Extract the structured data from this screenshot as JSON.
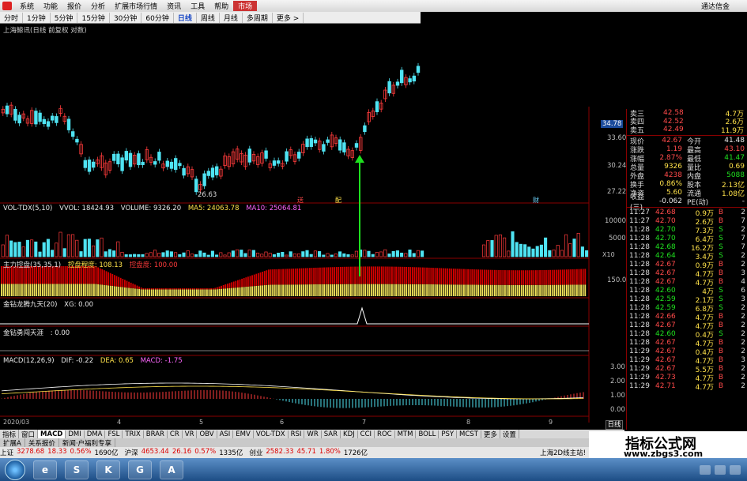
{
  "menu": {
    "items": [
      "系统",
      "功能",
      "报价",
      "分析",
      "扩展市场行情",
      "资讯",
      "工具",
      "帮助",
      "市场"
    ],
    "active_index": 8,
    "window_title": "通达信金"
  },
  "periods": {
    "items": [
      "分时",
      "1分钟",
      "5分钟",
      "15分钟",
      "30分钟",
      "60分钟",
      "日线",
      "周线",
      "月线",
      "多周期",
      "更多 >"
    ],
    "active_index": 6
  },
  "stock_title": "上海鲸讯(日线 前复权 对数)",
  "price_axis": [
    "33.60",
    "30.24",
    "27.22"
  ],
  "current_price_tag": "34.78",
  "low_marker": "26.63",
  "event_markers": [
    "送",
    "配",
    "财"
  ],
  "vol_label": {
    "name": "VOL-TDX(5,10)",
    "vvol": "VVOL: 18424.93",
    "volume": "VOLUME: 9326.20",
    "ma5": "MA5: 24063.78",
    "ma10": "MA10: 25064.81"
  },
  "vol_axis": [
    "10000",
    "5000"
  ],
  "vol_unit": "X10",
  "ctrl_label": {
    "name": "主力控盘(35,35,1)",
    "v1": "控盘程度: 108.13",
    "v2": "控盘度: 100.00"
  },
  "ctrl_axis": "150.0",
  "gold_label": {
    "name": "金钻龙腾九天(20)",
    "v": "XG: 0.00"
  },
  "heaven_label": {
    "name": "金钻勇闯天涯",
    "v": ": 0.00"
  },
  "macd_label": {
    "name": "MACD(12,26,9)",
    "dif": "DIF: -0.22",
    "dea": "DEA: 0.65",
    "macd": "MACD: -1.75"
  },
  "macd_axis": [
    "3.00",
    "2.00",
    "1.00",
    "0.00"
  ],
  "date_axis": [
    "2020/03",
    "4",
    "5",
    "6",
    "7",
    "8",
    "9"
  ],
  "orderbook": [
    {
      "label": "卖三",
      "price": "42.58",
      "vol": "4.7万"
    },
    {
      "label": "卖四",
      "price": "42.52",
      "vol": "2.6万"
    },
    {
      "label": "卖五",
      "price": "42.49",
      "vol": "11.9万"
    }
  ],
  "quote": [
    {
      "l1": "现价",
      "v1": "42.67",
      "c1": "red",
      "l2": "今开",
      "v2": "41.48",
      "c2": "white"
    },
    {
      "l1": "涨跌",
      "v1": "1.19",
      "c1": "red",
      "l2": "最高",
      "v2": "43.10",
      "c2": "red"
    },
    {
      "l1": "涨幅",
      "v1": "2.87%",
      "c1": "red",
      "l2": "最低",
      "v2": "41.47",
      "c2": "green"
    },
    {
      "l1": "总量",
      "v1": "9326",
      "c1": "yellow",
      "l2": "量比",
      "v2": "0.69",
      "c2": "yellow"
    },
    {
      "l1": "外盘",
      "v1": "4238",
      "c1": "red",
      "l2": "内盘",
      "v2": "5088",
      "c2": "green"
    },
    {
      "l1": "换手",
      "v1": "0.86%",
      "c1": "yellow",
      "l2": "股本",
      "v2": "2.13亿",
      "c2": "yellow"
    },
    {
      "l1": "净资",
      "v1": "5.60",
      "c1": "yellow",
      "l2": "流通",
      "v2": "1.08亿",
      "c2": "yellow"
    },
    {
      "l1": "收益(三)",
      "v1": "-0.062",
      "c1": "white",
      "l2": "PE(动)",
      "v2": "-",
      "c2": "white"
    }
  ],
  "ticks": [
    {
      "t": "11:27",
      "p": "42.68",
      "v": "0.9万",
      "bs": "B",
      "n": "2"
    },
    {
      "t": "11:27",
      "p": "42.70",
      "v": "2.6万",
      "bs": "B",
      "n": "7"
    },
    {
      "t": "11:28",
      "p": "42.70",
      "v": "7.3万",
      "bs": "S",
      "n": "2"
    },
    {
      "t": "11:28",
      "p": "42.70",
      "v": "6.4万",
      "bs": "S",
      "n": "7"
    },
    {
      "t": "11:28",
      "p": "42.68",
      "v": "16.2万",
      "bs": "S",
      "n": "7"
    },
    {
      "t": "11:28",
      "p": "42.64",
      "v": "3.4万",
      "bs": "S",
      "n": "2"
    },
    {
      "t": "11:28",
      "p": "42.67",
      "v": "0.9万",
      "bs": "B",
      "n": "2"
    },
    {
      "t": "11:28",
      "p": "42.67",
      "v": "4.7万",
      "bs": "B",
      "n": "3"
    },
    {
      "t": "11:28",
      "p": "42.67",
      "v": "4.7万",
      "bs": "B",
      "n": "4"
    },
    {
      "t": "11:28",
      "p": "42.60",
      "v": "4万",
      "bs": "S",
      "n": "6"
    },
    {
      "t": "11:28",
      "p": "42.59",
      "v": "2.1万",
      "bs": "S",
      "n": "3"
    },
    {
      "t": "11:28",
      "p": "42.59",
      "v": "6.8万",
      "bs": "S",
      "n": "2"
    },
    {
      "t": "11:28",
      "p": "42.66",
      "v": "4.7万",
      "bs": "B",
      "n": "2"
    },
    {
      "t": "11:28",
      "p": "42.67",
      "v": "4.7万",
      "bs": "B",
      "n": "2"
    },
    {
      "t": "11:28",
      "p": "42.60",
      "v": "0.4万",
      "bs": "S",
      "n": "2"
    },
    {
      "t": "11:28",
      "p": "42.67",
      "v": "4.7万",
      "bs": "B",
      "n": "2"
    },
    {
      "t": "11:29",
      "p": "42.67",
      "v": "0.4万",
      "bs": "B",
      "n": "2"
    },
    {
      "t": "11:29",
      "p": "42.67",
      "v": "4.7万",
      "bs": "B",
      "n": "3"
    },
    {
      "t": "11:29",
      "p": "42.67",
      "v": "5.5万",
      "bs": "B",
      "n": "2"
    },
    {
      "t": "11:29",
      "p": "42.73",
      "v": "4.7万",
      "bs": "B",
      "n": "2"
    },
    {
      "t": "11:29",
      "p": "42.71",
      "v": "4.7万",
      "bs": "B",
      "n": "2"
    }
  ],
  "indicator_tabs": [
    "指标",
    "窗口",
    "MACD",
    "DMI",
    "DMA",
    "FSL",
    "TRIX",
    "BRAR",
    "CR",
    "VR",
    "OBV",
    "ASI",
    "EMV",
    "VOL-TDX",
    "RSI",
    "WR",
    "SAR",
    "KDJ",
    "CCI",
    "ROC",
    "MTM",
    "BOLL",
    "PSY",
    "MCST",
    "更多",
    "设置"
  ],
  "indicator_active": 2,
  "day_button": "日线",
  "sub_tabs": [
    "扩展A",
    "关系报价",
    "新闻·户福利专享"
  ],
  "status": {
    "indices": [
      {
        "name": "上证",
        "value": "3278.68",
        "chg": "18.33",
        "pct": "0.56%",
        "amt": "1690亿"
      },
      {
        "name": "沪深",
        "value": "4653.44",
        "chg": "26.16",
        "pct": "0.57%",
        "amt": "1335亿"
      },
      {
        "name": "创业",
        "value": "2582.33",
        "chg": "45.71",
        "pct": "1.80%",
        "amt": "1726亿"
      }
    ],
    "right": "上海2D线主站!"
  },
  "watermark": {
    "line1": "指标公式网",
    "line2": "www.zbgs3.com"
  },
  "taskbar_apps": [
    "e",
    "S",
    "K",
    "G",
    "A"
  ],
  "colors": {
    "up": "#ff3b3b",
    "down": "#4fe3f2",
    "ctrl_red": "#d40000",
    "ctrl_yellow": "#f2e35a",
    "green_arrow": "#1fe01f"
  }
}
